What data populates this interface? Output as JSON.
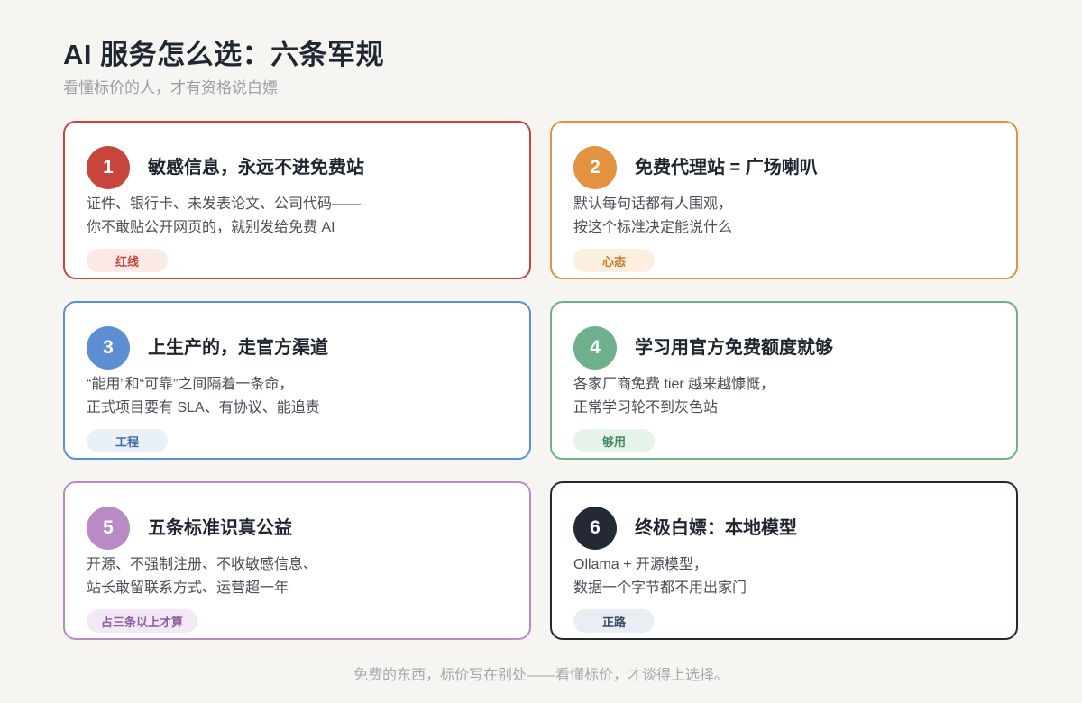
{
  "header": {
    "title": "AI 服务怎么选：六条军规",
    "subtitle": "看懂标价的人，才有资格说白嫖"
  },
  "cards": [
    {
      "number": "1",
      "title": "敏感信息，永远不进免费站",
      "desc_line1": "证件、银行卡、未发表论文、公司代码——",
      "desc_line2": "你不敢贴公开网页的，就别发给免费 AI",
      "tag": "红线",
      "accent": "#c8453c",
      "tag_bg": "#fbeae6",
      "tag_color": "#c8453c"
    },
    {
      "number": "2",
      "title": "免费代理站 = 广场喇叭",
      "desc_line1": "默认每句话都有人围观，",
      "desc_line2": "按这个标准决定能说什么",
      "tag": "心态",
      "accent": "#e3923f",
      "tag_bg": "#fcefe0",
      "tag_color": "#c9782c"
    },
    {
      "number": "3",
      "title": "上生产的，走官方渠道",
      "desc_line1": "“能用”和“可靠”之间隔着一条命，",
      "desc_line2": "正式项目要有 SLA、有协议、能追责",
      "tag": "工程",
      "accent": "#5b8fd1",
      "tag_bg": "#eaf0f8",
      "tag_color": "#3e6aa3"
    },
    {
      "number": "4",
      "title": "学习用官方免费额度就够",
      "desc_line1": "各家厂商免费 tier 越来越慷慨，",
      "desc_line2": "正常学习轮不到灰色站",
      "tag": "够用",
      "accent": "#6fb08c",
      "tag_bg": "#e6f3ea",
      "tag_color": "#3f8a5f"
    },
    {
      "number": "5",
      "title": "五条标准识真公益",
      "desc_line1": "开源、不强制注册、不收敏感信息、",
      "desc_line2": "站长敢留联系方式、运营超一年",
      "tag": "占三条以上才算",
      "accent": "#b98ac6",
      "tag_bg": "#f2e9f5",
      "tag_color": "#8e5aa0"
    },
    {
      "number": "6",
      "title": "终极白嫖：本地模型",
      "desc_line1": "Ollama + 开源模型，",
      "desc_line2": "数据一个字节都不用出家门",
      "tag": "正路",
      "accent": "#232a35",
      "tag_bg": "#e9eef4",
      "tag_color": "#3a4a60"
    }
  ],
  "footer": {
    "text": "免费的东西，标价写在别处——看懂标价，才谈得上选择。"
  }
}
